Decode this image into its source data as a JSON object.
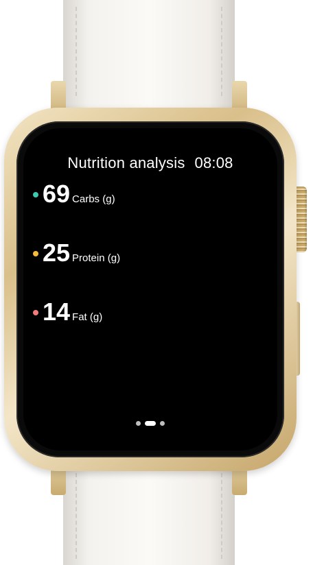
{
  "header": {
    "title": "Nutrition analysis",
    "time": "08:08"
  },
  "metrics": [
    {
      "value": "69",
      "label": "Carbs (g)",
      "color": "#3ec9b0"
    },
    {
      "value": "25",
      "label": "Protein (g)",
      "color": "#f5b942"
    },
    {
      "value": "14",
      "label": "Fat (g)",
      "color": "#f07b7b"
    }
  ],
  "pager": {
    "pages": 3,
    "active_index": 1
  },
  "device": {
    "case_color": "#d9bf8a",
    "band_color": "#f4f2ee"
  }
}
